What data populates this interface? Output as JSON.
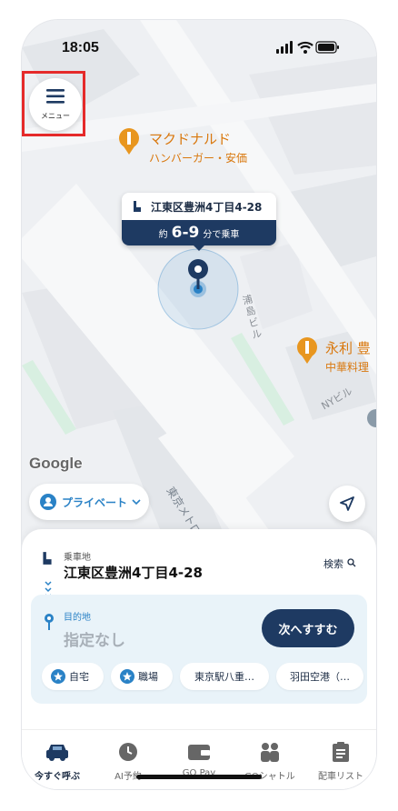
{
  "status_bar": {
    "time": "18:05"
  },
  "menu": {
    "label": "メニュー"
  },
  "map": {
    "poi_1": {
      "name": "マクドナルド",
      "sub": "ハンバーガー・安価"
    },
    "poi_2": {
      "name": "永利 豊",
      "sub": "中華料理"
    },
    "building_1": "浦島ビル",
    "building_2": "NYビル",
    "street": "東京メトロ有楽町",
    "pickup_callout": {
      "address": "江東区豊洲4丁目4-28",
      "prefix": "約",
      "eta": "6-9",
      "suffix": "分で乗車"
    },
    "attribution": "Google"
  },
  "profile_selector": {
    "label": "プライベート"
  },
  "sheet": {
    "pickup_label": "乗車地",
    "pickup_address": "江東区豊洲4丁目4-28",
    "search_label": "検索",
    "destination_label": "目的地",
    "destination_value": "指定なし",
    "next_button": "次へすすむ",
    "chips": [
      {
        "label": "自宅",
        "icon": "star-icon"
      },
      {
        "label": "職場",
        "icon": "star-icon"
      },
      {
        "label": "東京駅八重…"
      },
      {
        "label": "羽田空港（…"
      }
    ]
  },
  "tabs": [
    {
      "label": "今すぐ呼ぶ",
      "icon": "car-icon",
      "active": true
    },
    {
      "label": "AI予約",
      "icon": "clock-icon"
    },
    {
      "label": "GO Pay",
      "icon": "wallet-icon"
    },
    {
      "label": "GOシャトル",
      "icon": "people-icon"
    },
    {
      "label": "配車リスト",
      "icon": "clipboard-icon"
    }
  ],
  "colors": {
    "brand_navy": "#1e3a62",
    "accent_blue": "#2a82c6",
    "poi_orange": "#d9780e",
    "map_bg": "#eef0f3"
  }
}
